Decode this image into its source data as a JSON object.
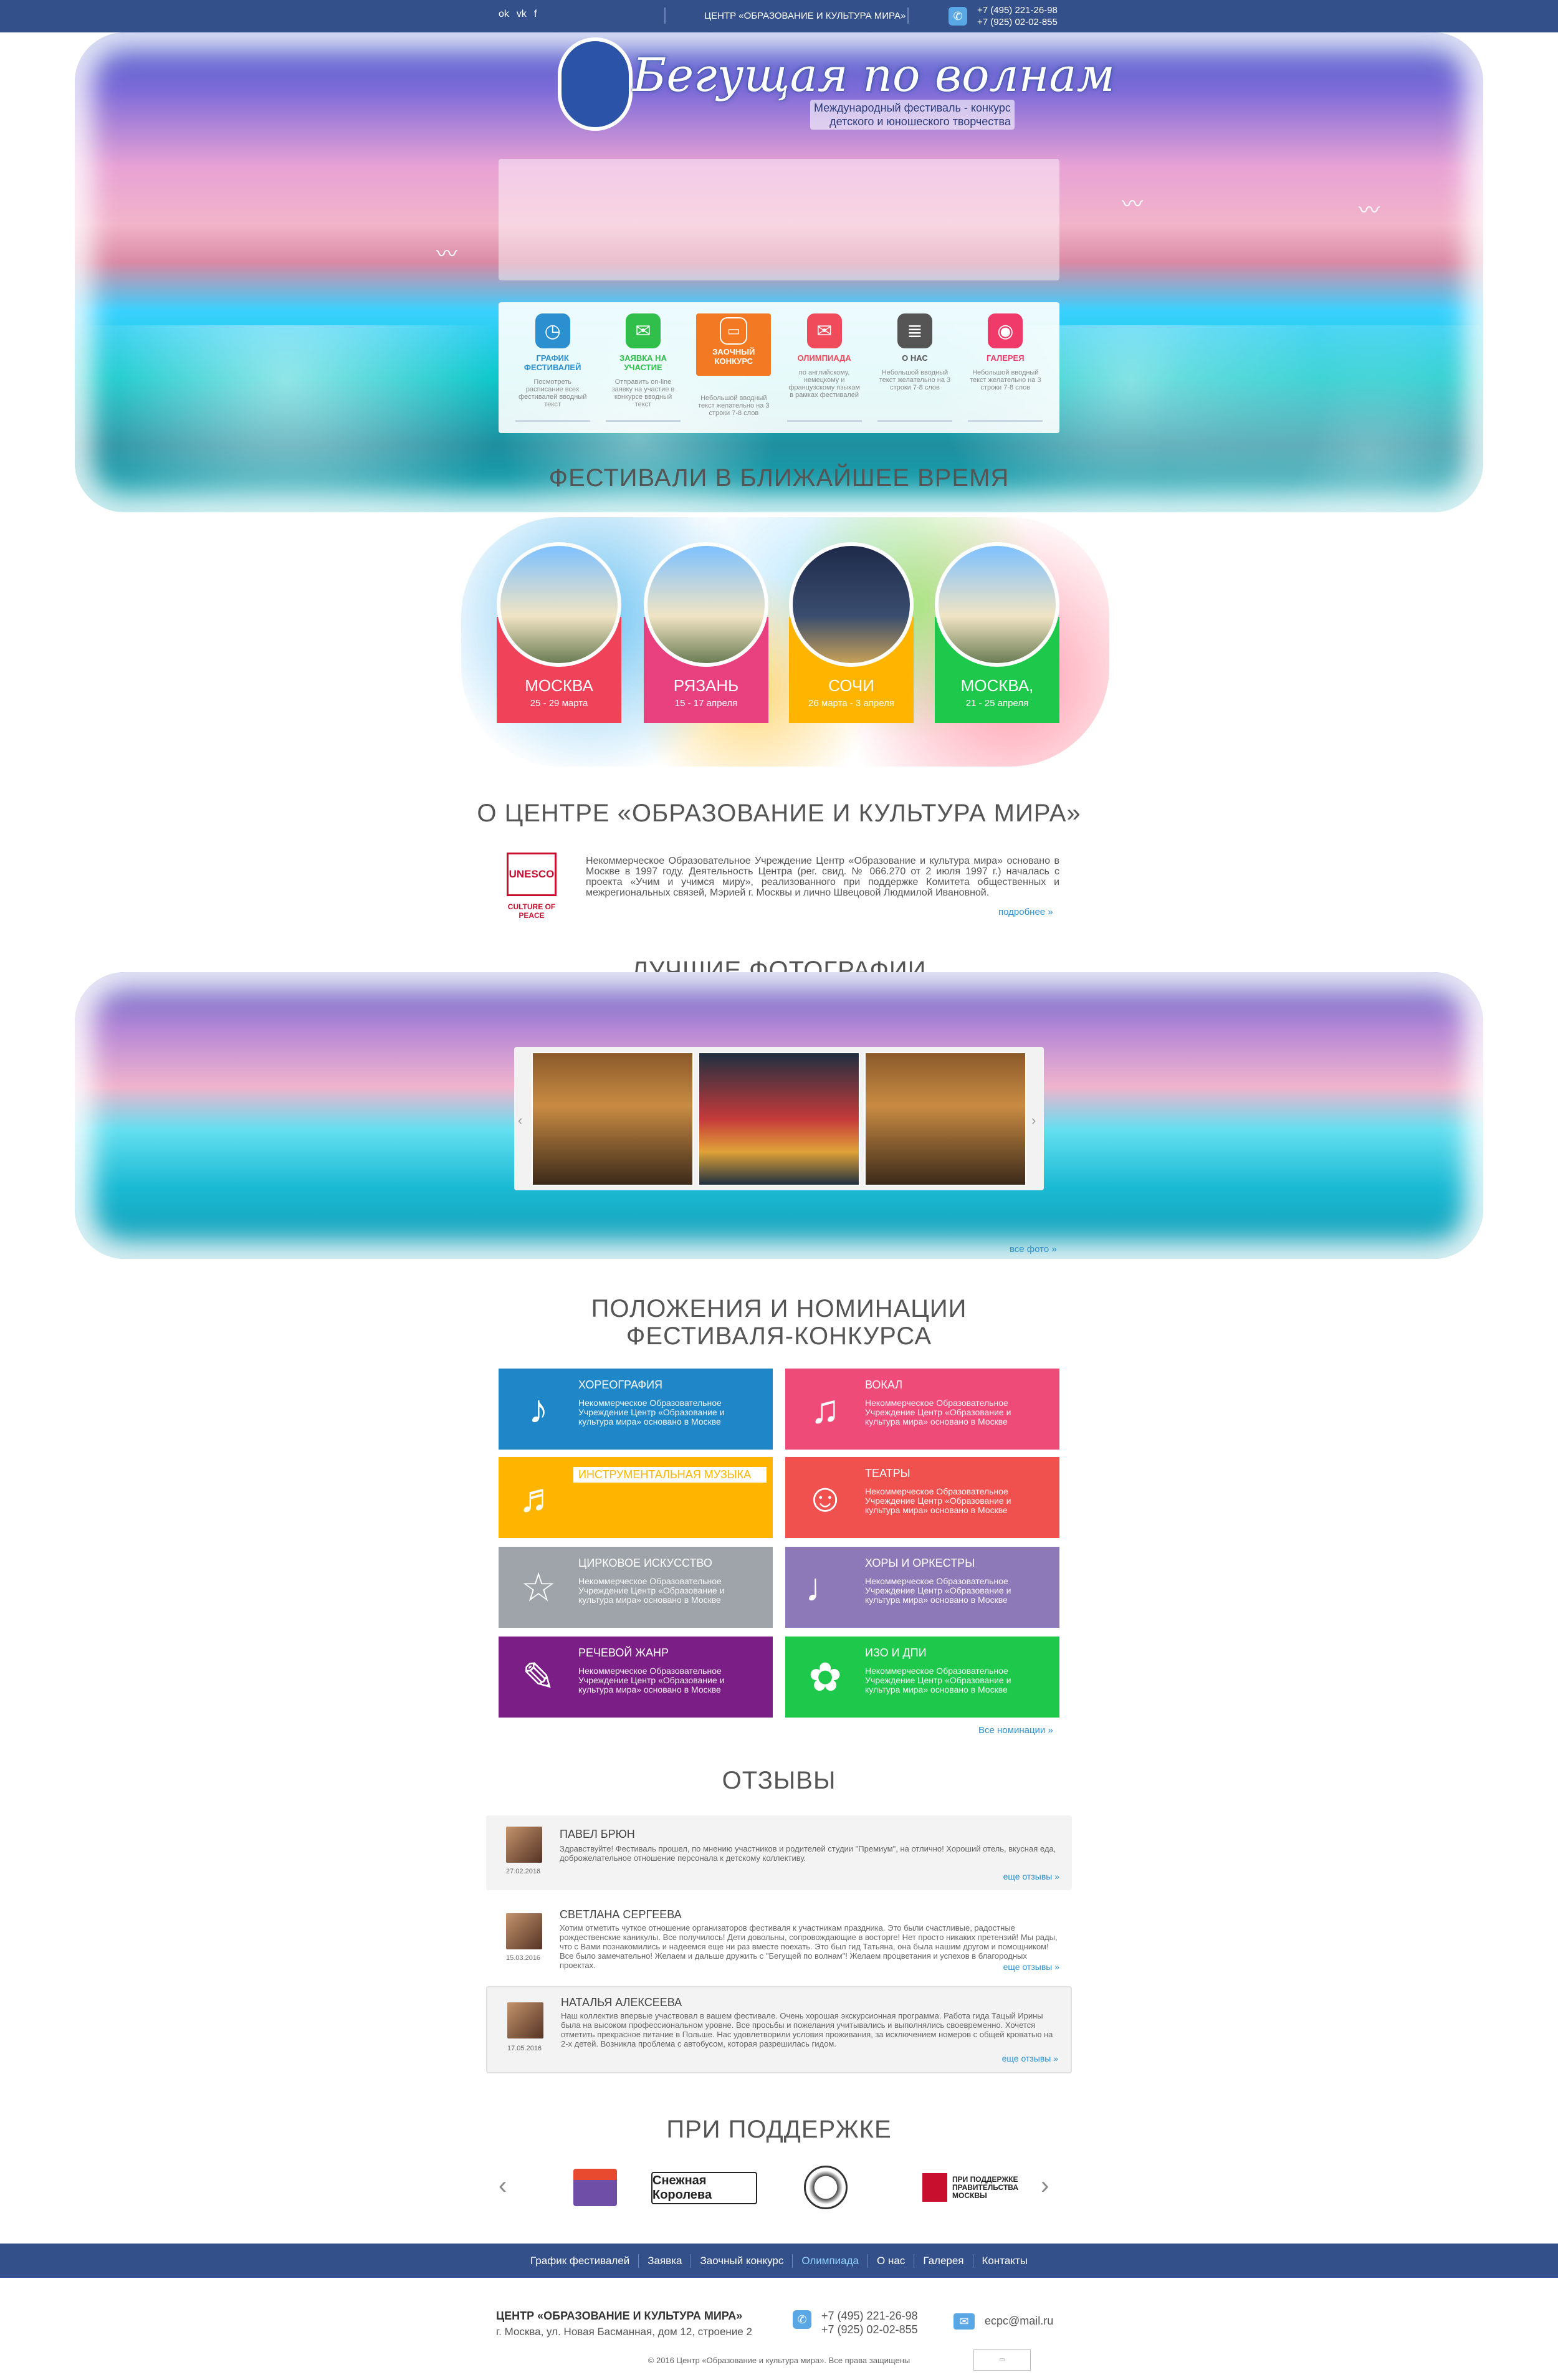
{
  "topbar": {
    "social": [
      "ok-icon",
      "vk-icon",
      "facebook-icon"
    ],
    "center_name": "ЦЕНТР «ОБРАЗОВАНИЕ И КУЛЬТУРА МИРА»",
    "phone1": "+7 (495) 221-26-98",
    "phone2": "+7 (925) 02-02-855"
  },
  "hero": {
    "logo_title": "Бегущая по волнам",
    "logo_sub1": "Международный фестиваль - конкурс",
    "logo_sub2": "детского и юношеского творчества"
  },
  "cards": [
    {
      "title": "ГРАФИК ФЕСТИВАЛЕЙ",
      "desc": "Посмотреть расписание всех фестивалей вводный текст",
      "color": "#2b8fd0",
      "icon": "calendar-icon"
    },
    {
      "title": "ЗАЯВКА НА УЧАСТИЕ",
      "desc": "Отправить on-line заявку на участие в конкурсе вводный текст",
      "color": "#2fbf4a",
      "icon": "mail-icon"
    },
    {
      "title": "ЗАОЧНЫЙ КОНКУРС",
      "desc": "Небольшой вводный текст желательно на 3 строки 7-8 слов",
      "color": "#f37a23",
      "icon": "monitor-icon"
    },
    {
      "title": "ОЛИМПИАДА",
      "desc": "по английскому, немецкому и французскому языкам в рамках фестивалей",
      "color": "#ef4b5a",
      "icon": "chat-icon"
    },
    {
      "title": "О НАС",
      "desc": "Небольшой вводный текст желательно на 3 строки 7-8 слов",
      "color": "#555555",
      "icon": "document-icon"
    },
    {
      "title": "ГАЛЕРЕЯ",
      "desc": "Небольшой вводный текст желательно на 3 строки 7-8 слов",
      "color": "#ef3a6a",
      "icon": "camera-icon"
    }
  ],
  "festivals": {
    "heading": "ФЕСТИВАЛИ В БЛИЖАЙШЕЕ ВРЕМЯ",
    "items": [
      {
        "city": "МОСКВА",
        "date": "25 - 29 марта",
        "color": "#f0435a"
      },
      {
        "city": "РЯЗАНЬ",
        "date": "15 - 17 апреля",
        "color": "#e9407f"
      },
      {
        "city": "СОЧИ",
        "date": "26 марта - 3 апреля",
        "color": "#ffb400"
      },
      {
        "city": "МОСКВА,",
        "date": "21 - 25 апреля",
        "color": "#1ec84a"
      }
    ]
  },
  "about": {
    "heading": "О ЦЕНТРЕ «ОБРАЗОВАНИЕ И КУЛЬТУРА МИРА»",
    "logo_text": "UNESCO",
    "logo_caption": "CULTURE OF PEACE",
    "text": "Некоммерческое Образовательное Учреждение Центр «Образование и культура мира» основано в Москве в 1997 году. Деятельность Центра (рег. свид. № 066.270 от 2 июля 1997 г.) началась с проекта «Учим и учимся миру», реализованного при поддержке Комитета общественных и межрегиональных связей, Мэрией г. Москвы и лично Швецовой Людмилой Ивановной.",
    "more": "подробнее »"
  },
  "photos": {
    "heading": "ЛУЧШИЕ ФОТОГРАФИИ",
    "prev": "‹",
    "next": "›",
    "all": "все фото »"
  },
  "nominations": {
    "heading1": "ПОЛОЖЕНИЯ И НОМИНАЦИИ",
    "heading2": "ФЕСТИВАЛЯ-КОНКУРСА",
    "items": [
      {
        "title": "ХОРЕОГРАФИЯ",
        "desc": "Некоммерческое Образовательное Учреждение Центр «Образование и культура мира» основано в Москве",
        "color": "#1f86c8",
        "icon": "dancer-icon",
        "glyph": "♪"
      },
      {
        "title": "ВОКАЛ",
        "desc": "Некоммерческое Образовательное Учреждение Центр «Образование и культура мира» основано в Москве",
        "color": "#ef4b79",
        "icon": "singer-icon",
        "glyph": "♫"
      },
      {
        "title": "ИНСТРУМЕНТАЛЬНАЯ МУЗЫКА",
        "desc": "",
        "color": "#ffb400",
        "icon": "piano-icon",
        "glyph": "♬"
      },
      {
        "title": "ТЕАТРЫ",
        "desc": "Некоммерческое Образовательное Учреждение Центр «Образование и культура мира» основано в Москве",
        "color": "#f0514f",
        "icon": "masks-icon",
        "glyph": "☺"
      },
      {
        "title": "ЦИРКОВОЕ ИСКУССТВО",
        "desc": "Некоммерческое Образовательное Учреждение Центр «Образование и культура мира» основано в Москве",
        "color": "#9ea4a9",
        "icon": "acrobat-icon",
        "glyph": "☆"
      },
      {
        "title": "ХОРЫ И ОРКЕСТРЫ",
        "desc": "Некоммерческое Образовательное Учреждение Центр «Образование и культура мира» основано в Москве",
        "color": "#8d79b8",
        "icon": "choir-icon",
        "glyph": "♩"
      },
      {
        "title": "РЕЧЕВОЙ ЖАНР",
        "desc": "Некоммерческое Образовательное Учреждение Центр «Образование и культура мира» основано в Москве",
        "color": "#7b1f86",
        "icon": "book-icon",
        "glyph": "✎"
      },
      {
        "title": "ИЗО И ДПИ",
        "desc": "Некоммерческое Образовательное Учреждение Центр «Образование и культура мира» основано в Москве",
        "color": "#1ec84a",
        "icon": "palette-icon",
        "glyph": "✿"
      }
    ],
    "all": "Все номинации »"
  },
  "reviews": {
    "heading": "ОТЗЫВЫ",
    "items": [
      {
        "name": "ПАВЕЛ БРЮН",
        "date": "27.02.2016",
        "text": "Здравствуйте! Фестиваль прошел, по мнению участников и родителей студии \"Премиум\", на отлично! Хороший отель, вкусная еда, доброжелательное отношение персонала к детскому коллективу.",
        "more": "еще отзывы »"
      },
      {
        "name": "СВЕТЛАНА СЕРГЕЕВА",
        "date": "15.03.2016",
        "text": "Хотим отметить чуткое отношение организаторов фестиваля к участникам праздника. Это были счастливые, радостные рождественские каникулы. Все получилось! Дети довольны, сопровождающие в восторге! Нет просто никаких претензий! Мы рады, что с Вами познакомились и надеемся еще ни раз вместе поехать. Это был гид Татьяна, она была нашим другом и помощником! Все было замечательно! Желаем и дальше дружить с \"Бегущей по волнам\"! Желаем процветания и успехов в благородных проектах.",
        "more": "еще отзывы »"
      },
      {
        "name": "НАТАЛЬЯ АЛЕКСЕЕВА",
        "date": "17.05.2016",
        "text": "Наш коллектив впервые участвовал в вашем фестивале. Очень хорошая экскурсионная программа. Работа гида Тацый Ирины была на высоком профессиональном уровне. Все просьбы и пожелания учитывались и выполнялись своевременно. Хочется отметить прекрасное питание в Польше. Нас удовлетворили условия проживания, за исключением номеров с общей кроватью на 2-х детей. Возникла проблема с автобусом, которая разрешилась гидом.",
        "more": "еще отзывы »"
      }
    ]
  },
  "partners": {
    "heading": "ПРИ ПОДДЕРЖКЕ",
    "logos": [
      {
        "text": "",
        "icon": "house-logo"
      },
      {
        "text": "Снежная Королева",
        "icon": "snow-queen-logo"
      },
      {
        "text": "",
        "icon": "emblem-logo"
      },
      {
        "text": "ПРИ ПОДДЕРЖКЕ ПРАВИТЕЛЬСТВА МОСКВЫ",
        "icon": "moscow-gov-logo"
      }
    ],
    "prev": "‹",
    "next": "›"
  },
  "footer": {
    "nav": [
      "График фестивалей",
      "Заявка",
      "Заочный конкурс",
      "Олимпиада",
      "О нас",
      "Галерея",
      "Контакты"
    ],
    "title": "ЦЕНТР «ОБРАЗОВАНИЕ И КУЛЬТУРА МИРА»",
    "address": "г. Москва, ул. Новая Басманная, дом 12, строение 2",
    "phone1": "+7 (495) 221-26-98",
    "phone2": "+7 (925) 02-02-855",
    "email": "ecpc@mail.ru",
    "copyright": "© 2016 Центр «Образование и культура мира». Все права защищены"
  }
}
